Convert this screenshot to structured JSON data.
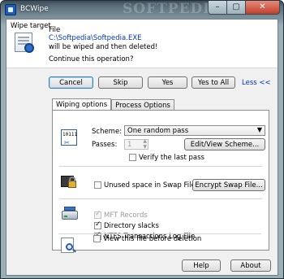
{
  "window": {
    "title": "BCWipe",
    "watermark": "SOFTPEDIA"
  },
  "title_buttons": {
    "minimize": "–",
    "maximize": "▢",
    "close": "✕"
  },
  "header": {
    "wipe_target": "Wipe target",
    "file_label": "File",
    "file_path": "C:\\Softpedia\\Softpedia.EXE",
    "will_be": "will be wiped and then deleted!",
    "question": "Continue this operation?"
  },
  "action_buttons": {
    "cancel": "Cancel",
    "skip": "Skip",
    "yes": "Yes",
    "yes_to_all": "Yes to All",
    "less": "Less <<"
  },
  "tabs": [
    "Wiping options",
    "Process Options"
  ],
  "wiping": {
    "scheme_label": "Scheme:",
    "scheme_value": "One random pass",
    "passes_label": "Passes:",
    "passes_value": "1",
    "edit_scheme": "Edit/View Scheme...",
    "verify_last": "Verify the last pass",
    "icon_text": "10111"
  },
  "swap": {
    "unused_swap": "Unused space in Swap File",
    "encrypt_swap": "Encrypt Swap File..."
  },
  "ntfs": {
    "mft": "MFT Records",
    "dir_slacks": "Directory slacks",
    "ntfs_log": "NTFS Transactions Log File"
  },
  "view": {
    "view_before": "View this file before deletion"
  },
  "footer": {
    "help": "Help",
    "about": "About"
  }
}
